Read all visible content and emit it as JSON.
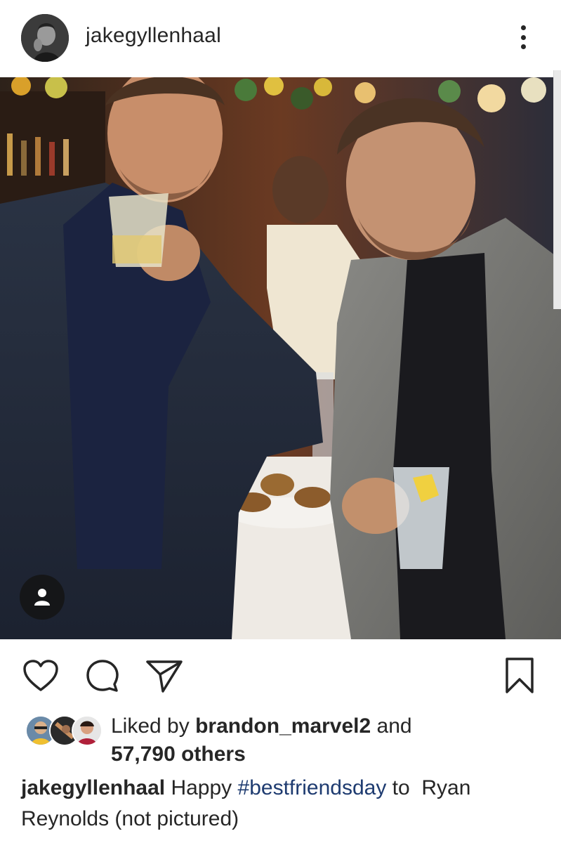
{
  "header": {
    "username": "jakegyllenhaal",
    "more_icon": "more-vertical-icon"
  },
  "photo": {
    "tag_icon": "person-icon"
  },
  "actions": {
    "like_icon": "heart-icon",
    "comment_icon": "comment-icon",
    "share_icon": "send-icon",
    "save_icon": "bookmark-icon"
  },
  "likes": {
    "prefix": "Liked by",
    "user": "brandon_marvel2",
    "conjunction": "and",
    "count_text": "57,790 others"
  },
  "caption": {
    "username": "jakegyllenhaal",
    "text_before": "Happy",
    "hashtag": "#bestfriendsday",
    "text_after": "to  Ryan Reynolds (not pictured)"
  },
  "colors": {
    "text": "#262626",
    "hashtag": "#1e3b70",
    "background": "#ffffff"
  }
}
